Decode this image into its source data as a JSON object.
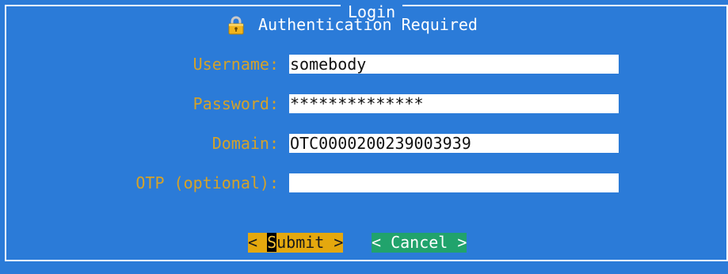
{
  "dialog": {
    "title": "Login",
    "heading": "Authentication Required"
  },
  "form": {
    "username": {
      "label": "Username:",
      "value": "somebody"
    },
    "password": {
      "label": "Password:",
      "value": "**************"
    },
    "domain": {
      "label": "Domain:",
      "value": "OTC0000200239003939"
    },
    "otp": {
      "label": "OTP (optional):",
      "value": ""
    }
  },
  "buttons": {
    "submit": {
      "prefix": "< ",
      "hotkey": "S",
      "rest": "ubmit >"
    },
    "cancel": {
      "label": "< Cancel >"
    }
  },
  "colors": {
    "background": "#2b7bd8",
    "label": "#d4a22a",
    "submit_button": "#e4a80e",
    "cancel_button": "#21a36c",
    "input": "#ffffff"
  },
  "icons": {
    "heading_icon": "lock-icon"
  }
}
